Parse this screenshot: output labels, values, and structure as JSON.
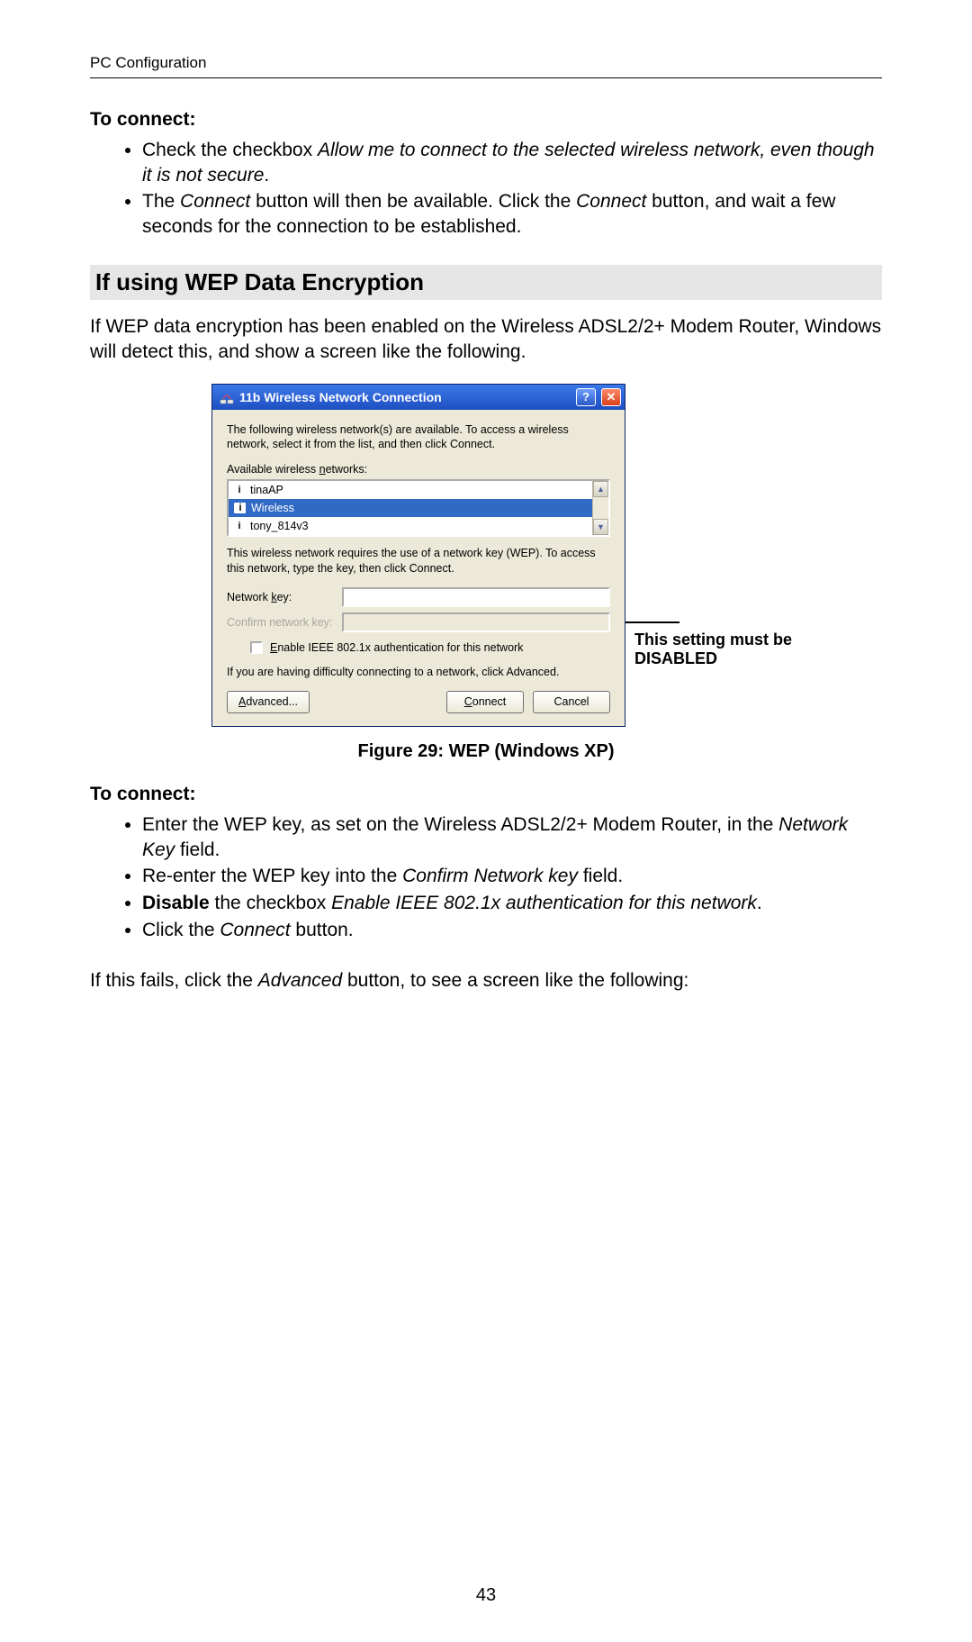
{
  "header": "PC Configuration",
  "page_number": "43",
  "section1": {
    "subhead": "To connect:",
    "bullets": [
      {
        "pre": "Check the checkbox ",
        "italic": "Allow me to connect to the selected wireless network, even though it is not secure",
        "post": "."
      },
      {
        "pre": "The ",
        "italic1": "Connect",
        "mid": " button will then be available. Click the ",
        "italic2": "Connect",
        "post": " button, and wait a few seconds for the connection to be established."
      }
    ]
  },
  "section2": {
    "heading": "If using WEP Data Encryption",
    "intro": "If WEP data encryption has been enabled on the Wireless ADSL2/2+ Modem Router, Windows will detect this, and show a screen like the following.",
    "figure_caption": "Figure 29: WEP (Windows XP)"
  },
  "dialog": {
    "title": "11b Wireless Network Connection",
    "help_symbol": "?",
    "close_symbol": "✕",
    "intro_text": "The following wireless network(s) are available. To access a wireless network, select it from the list, and then click Connect.",
    "list_label_pre": "Available wireless ",
    "list_label_u": "n",
    "list_label_post": "etworks:",
    "networks": [
      "tinaAP",
      "Wireless",
      "tony_814v3"
    ],
    "wep_text": "This wireless network requires the use of a network key (WEP). To access this network, type the key, then click Connect.",
    "netkey_pre": "Network ",
    "netkey_u": "k",
    "netkey_post": "ey:",
    "confirmkey": "Confirm network key:",
    "checkbox_u": "E",
    "checkbox_post": "nable IEEE 802.1x authentication for this network",
    "trouble_text": "If you are having difficulty connecting to a network, click Advanced.",
    "advanced_u": "A",
    "advanced_post": "dvanced...",
    "connect_u": "C",
    "connect_post": "onnect",
    "cancel": "Cancel",
    "annotation": "This setting must be DISABLED"
  },
  "section3": {
    "subhead": "To connect:",
    "b1_pre": "Enter the WEP key, as set on the Wireless ADSL2/2+ Modem Router, in the ",
    "b1_italic": "Network Key",
    "b1_post": " field.",
    "b2_pre": "Re-enter the WEP key into the ",
    "b2_italic": "Confirm Network key",
    "b2_post": " field.",
    "b3_bold": "Disable",
    "b3_mid": " the checkbox ",
    "b3_italic": "Enable IEEE 802.1x authentication for this network",
    "b3_post": ".",
    "b4_pre": "Click the ",
    "b4_italic": "Connect",
    "b4_post": " button.",
    "tail_pre": "If this fails, click the ",
    "tail_italic": "Advanced",
    "tail_post": " button, to see a screen like the following:"
  }
}
